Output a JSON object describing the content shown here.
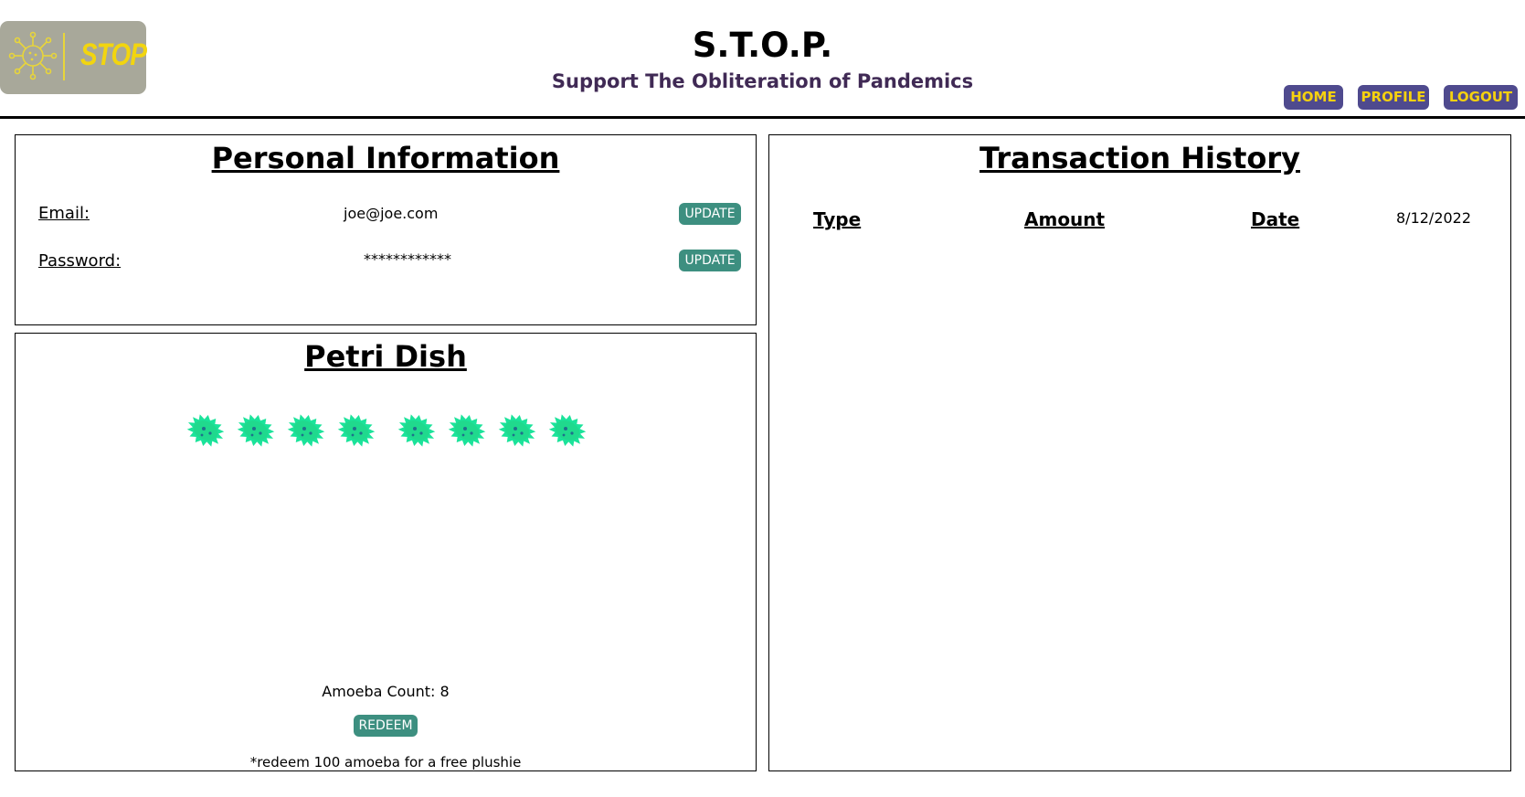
{
  "header": {
    "logo_text": "STOP",
    "title": "S.T.O.P.",
    "subtitle": "Support The Obliteration of Pandemics",
    "nav": [
      {
        "label": "HOME"
      },
      {
        "label": "PROFILE"
      },
      {
        "label": "LOGOUT"
      }
    ],
    "colors": {
      "nav_bg": "#4f4a8e",
      "nav_text": "#f5d10f",
      "logo_bg": "#a8a89a",
      "subtitle": "#402a55"
    }
  },
  "personal": {
    "title": "Personal Information",
    "email_label": "Email:",
    "email_value": "joe@joe.com",
    "password_label": "Password:",
    "password_value": "************",
    "update_label": "UPDATE"
  },
  "petri": {
    "title": "Petri Dish",
    "amoeba_icon": "amoeba-icon",
    "amoeba_color": "#1be39a",
    "amoeba_count": 8,
    "count_text": "Amoeba Count: 8",
    "redeem_label": "REDEEM",
    "note": "*redeem 100 amoeba for a free plushie"
  },
  "transactions": {
    "title": "Transaction History",
    "columns": [
      "Type",
      "Amount",
      "Date"
    ],
    "rows": [
      {
        "type": "",
        "amount": "",
        "date": "8/12/2022"
      }
    ]
  },
  "accent_button_color": "#3d8f80"
}
